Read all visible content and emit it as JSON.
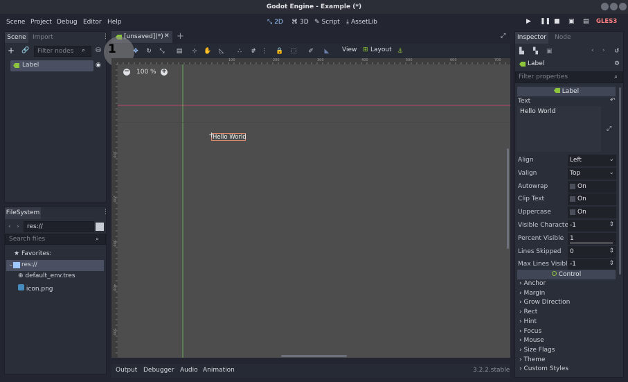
{
  "window": {
    "title": "Godot Engine - Example (*)"
  },
  "menu": {
    "items": [
      "Scene",
      "Project",
      "Debug",
      "Editor",
      "Help"
    ]
  },
  "modes": {
    "d2": "2D",
    "d3": "3D",
    "script": "Script",
    "assetlib": "AssetLib"
  },
  "renderer": "GLES3",
  "scene_dock": {
    "tab_scene": "Scene",
    "tab_import": "Import",
    "filter_placeholder": "Filter nodes",
    "node_label": "Label"
  },
  "filesystem": {
    "tab": "FileSystem",
    "path": "res://",
    "search_placeholder": "Search files",
    "favorites": "Favorites:",
    "root": "res://",
    "files": [
      "default_env.tres",
      "icon.png"
    ]
  },
  "editor": {
    "tab_title": "[unsaved](*)",
    "step_badge": "1",
    "zoom": "100 %",
    "view_label": "View",
    "layout_label": "Layout",
    "ruler_labels": [
      "100",
      "200",
      "300",
      "400",
      "500",
      "600",
      "700"
    ],
    "ruler_v_labels": [
      "100",
      "200",
      "300",
      "400",
      "500"
    ],
    "label_text": "Hello World"
  },
  "bottom_panel": {
    "tabs": [
      "Output",
      "Debugger",
      "Audio",
      "Animation"
    ],
    "version": "3.2.2.stable"
  },
  "inspector": {
    "tab_inspector": "Inspector",
    "tab_node": "Node",
    "object_name": "Label",
    "filter_placeholder": "Filter properties",
    "section_label": "Label",
    "text_label": "Text",
    "text_value": "Hello World",
    "props": [
      {
        "name": "Align",
        "value": "Left",
        "kind": "dropdown"
      },
      {
        "name": "Valign",
        "value": "Top",
        "kind": "dropdown"
      },
      {
        "name": "Autowrap",
        "value": "On",
        "kind": "check"
      },
      {
        "name": "Clip Text",
        "value": "On",
        "kind": "check"
      },
      {
        "name": "Uppercase",
        "value": "On",
        "kind": "check"
      },
      {
        "name": "Visible Characte",
        "value": "-1",
        "kind": "spin"
      },
      {
        "name": "Percent Visible",
        "value": "1",
        "kind": "slider"
      },
      {
        "name": "Lines Skipped",
        "value": "0",
        "kind": "spin"
      },
      {
        "name": "Max Lines Visibl",
        "value": "-1",
        "kind": "spin"
      }
    ],
    "control_section": "Control",
    "control_items": [
      "Anchor",
      "Margin",
      "Grow Direction",
      "Rect",
      "Hint",
      "Focus",
      "Mouse",
      "Size Flags",
      "Theme",
      "Custom Styles"
    ]
  },
  "colors": {
    "accent": "#8cc43c",
    "selection": "#4a5062",
    "gles": "#ff7f7f"
  }
}
